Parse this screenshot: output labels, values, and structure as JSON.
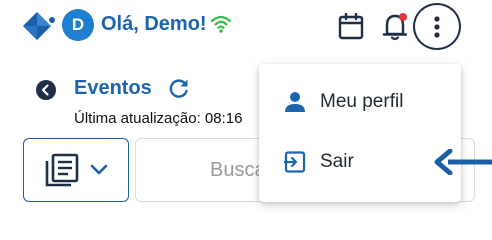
{
  "header": {
    "avatar_initial": "D",
    "greeting": "Olá, Demo!",
    "icons": [
      "app-logo-icon",
      "wifi-icon",
      "calendar-icon",
      "bell-icon",
      "more-vertical-icon"
    ],
    "notification_dot_color": "#e3333f"
  },
  "page": {
    "title": "Eventos",
    "last_update": "Última atualização: 08:16"
  },
  "controls": {
    "search_placeholder": "Buscar"
  },
  "menu": {
    "items": [
      {
        "label": "Meu perfil",
        "icon": "person-icon"
      },
      {
        "label": "Sair",
        "icon": "logout-icon"
      }
    ]
  },
  "colors": {
    "brand_blue": "#1c64b0",
    "avatar_blue": "#1e7fd1",
    "wifi_green": "#2fbf4a",
    "dark_navy": "#1f2e48"
  }
}
